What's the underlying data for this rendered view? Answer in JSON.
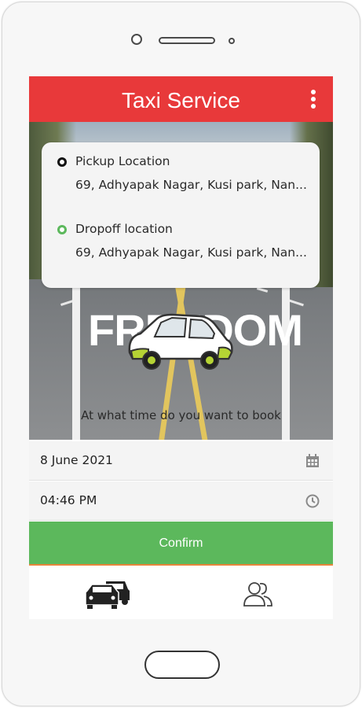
{
  "app": {
    "title": "Taxi Service"
  },
  "header": {
    "menu_icon": "more-vertical-icon"
  },
  "hero": {
    "banner_text": "FREEDOM",
    "caption": "At what time do you want to book"
  },
  "pickup": {
    "label": "Pickup Location",
    "address": "69, Adhyapak Nagar, Kusi park, Nan..."
  },
  "dropoff": {
    "label": "Dropoff location",
    "address": "69, Adhyapak Nagar, Kusi park, Nan..."
  },
  "date": {
    "value": "8 June 2021",
    "icon": "calendar-icon"
  },
  "time": {
    "value": "04:46 PM",
    "icon": "clock-icon"
  },
  "confirm": {
    "label": "Confirm"
  },
  "bottom_nav": {
    "items": [
      {
        "icon": "taxi-icon"
      },
      {
        "icon": "users-icon"
      }
    ]
  },
  "colors": {
    "header": "#e8393a",
    "confirm": "#5cb85c",
    "dropoff_dot": "#5cb85c"
  }
}
